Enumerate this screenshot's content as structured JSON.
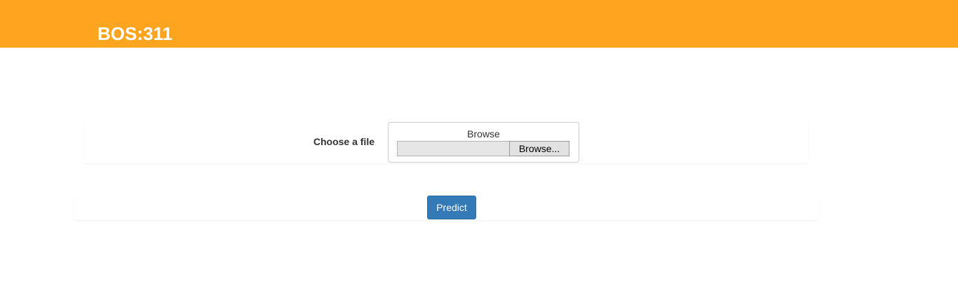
{
  "header": {
    "title": "BOS:311",
    "background_color": "#ffa41e"
  },
  "upload_form": {
    "label": "Choose a file",
    "box_title": "Browse",
    "browse_button_label": "Browse..."
  },
  "actions": {
    "predict_label": "Predict",
    "predict_color": "#337ab7"
  }
}
